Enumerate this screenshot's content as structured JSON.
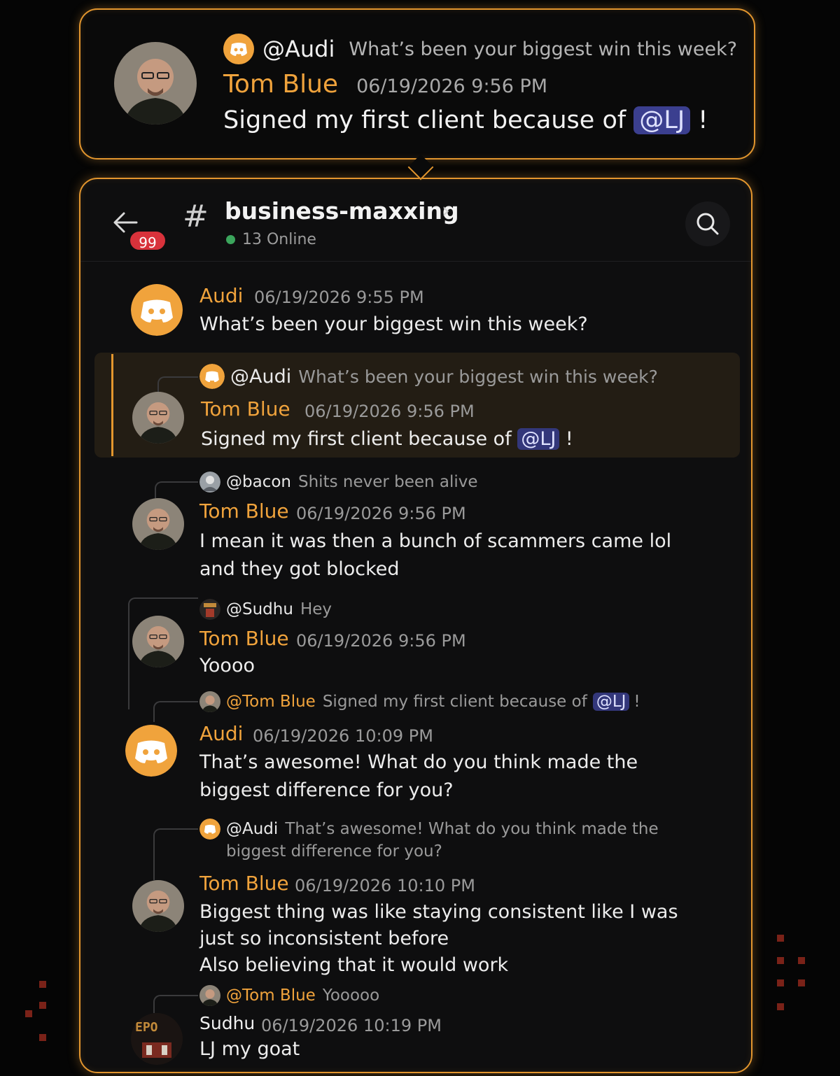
{
  "callout": {
    "reply_name": "@Audi",
    "reply_text": "What’s been your biggest win this week?",
    "author": "Tom Blue",
    "time": "06/19/2026 9:56 PM",
    "message_prefix": "Signed my first client because of",
    "mention": "@LJ",
    "message_suffix": "!"
  },
  "header": {
    "badge_count": "99",
    "hash": "#",
    "channel_name": "business-maxxing",
    "chevron": "›",
    "online_text": "13 Online"
  },
  "messages": [
    {
      "author": "Audi",
      "time": "06/19/2026 9:55 PM",
      "lines": [
        "What’s been your biggest win this week?"
      ]
    },
    {
      "reply_name": "@Audi",
      "reply_text": "What’s been your biggest win this week?",
      "author": "Tom Blue",
      "time": "06/19/2026 9:56 PM",
      "text_prefix": "Signed my first client because of",
      "mention": "@LJ",
      "text_suffix": "!"
    },
    {
      "reply_name": "@bacon",
      "reply_text": "Shits never been alive",
      "author": "Tom Blue",
      "time": "06/19/2026 9:56 PM",
      "lines": [
        "I mean it was then a bunch of scammers came lol",
        "and they got blocked"
      ]
    },
    {
      "reply_name": "@Sudhu",
      "reply_text": "Hey",
      "author": "Tom Blue",
      "time": "06/19/2026 9:56 PM",
      "lines": [
        "Yoooo"
      ]
    },
    {
      "reply_name": "@Tom Blue",
      "reply_text_prefix": "Signed my first client because of",
      "reply_mention": "@LJ",
      "reply_text_suffix": "!",
      "author": "Audi",
      "time": "06/19/2026 10:09 PM",
      "lines": [
        "That’s awesome! What do you think made the",
        "biggest difference for you?"
      ]
    },
    {
      "reply_name": "@Audi",
      "reply_text_line1": "That’s awesome! What do you think made the",
      "reply_text_line2": "biggest difference for you?",
      "author": "Tom Blue",
      "time": "06/19/2026 10:10 PM",
      "lines": [
        "Biggest thing was like staying consistent like I was",
        "just so inconsistent before",
        "Also believing that it would work"
      ]
    },
    {
      "reply_name": "@Tom Blue",
      "reply_text": "Yooooo",
      "author": "Sudhu",
      "time": "06/19/2026 10:19 PM",
      "lines": [
        "LJ my goat"
      ]
    }
  ],
  "sudhu_avatar_text": "EPO",
  "colors": {
    "accent": "#f0a33c",
    "border": "#e3962e",
    "mention_bg": "#3b3f8f",
    "badge": "#d8323b",
    "online": "#3ba55c",
    "highlight": "#231d14"
  },
  "icons": [
    "discord-icon",
    "back-arrow-icon",
    "search-icon",
    "hash-icon",
    "chevron-right-icon"
  ]
}
